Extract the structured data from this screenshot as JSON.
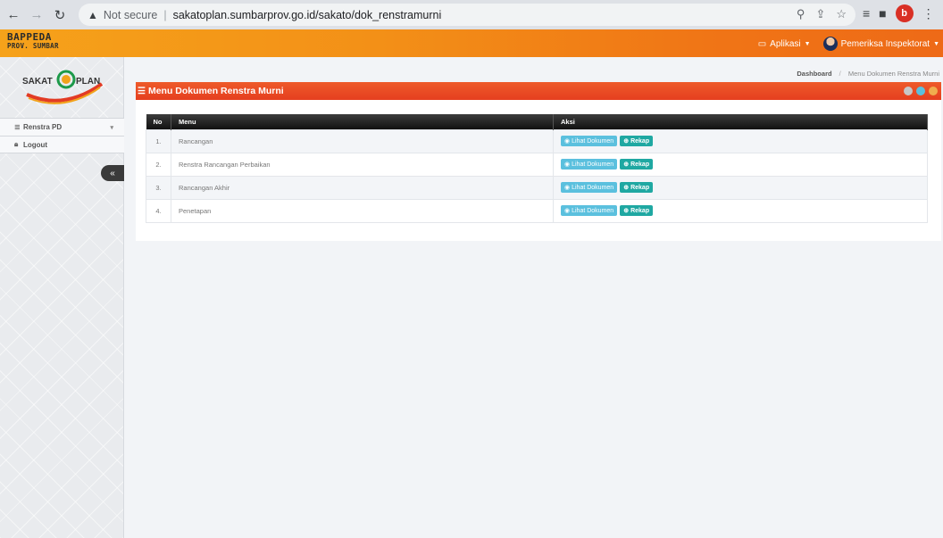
{
  "browser": {
    "warning": "▲",
    "not_secure": "Not secure",
    "url": "sakatoplan.sumbarprov.go.id/sakato/dok_renstramurni",
    "profile_initial": "b"
  },
  "header": {
    "brand_line1": "BAPPEDA",
    "brand_line2": "PROV. SUMBAR",
    "aplikasi_label": "Aplikasi",
    "user_label": "Pemeriksa Inspektorat",
    "bg_colors": [
      "#f6a21a",
      "#ee6a17"
    ]
  },
  "sidebar": {
    "logo_text_left": "SAKAT",
    "logo_text_right": "PLAN",
    "items": [
      {
        "label": "Renstra PD",
        "icon": "database-icon"
      },
      {
        "label": "Logout",
        "icon": "lock-icon"
      }
    ],
    "collapse_label": "«"
  },
  "breadcrumb": {
    "home": "Dashboard",
    "separator": "/",
    "current": "Menu Dokumen Renstra Murni"
  },
  "panel": {
    "title": "Menu Dokumen Renstra Murni",
    "accent": "#e53f1f",
    "tool_colors": [
      "#c7c7c7",
      "#5bc0de",
      "#f0ad4e"
    ]
  },
  "table": {
    "headers": [
      "No",
      "Menu",
      "Aksi"
    ],
    "rows": [
      {
        "no": "1.",
        "menu": "Rancangan",
        "btn_view": "Lihat Dokumen",
        "btn_rekap": "Rekap"
      },
      {
        "no": "2.",
        "menu": "Renstra Rancangan Perbaikan",
        "btn_view": "Lihat Dokumen",
        "btn_rekap": "Rekap"
      },
      {
        "no": "3.",
        "menu": "Rancangan Akhir",
        "btn_view": "Lihat Dokumen",
        "btn_rekap": "Rekap"
      },
      {
        "no": "4.",
        "menu": "Penetapan",
        "btn_view": "Lihat Dokumen",
        "btn_rekap": "Rekap"
      }
    ]
  }
}
